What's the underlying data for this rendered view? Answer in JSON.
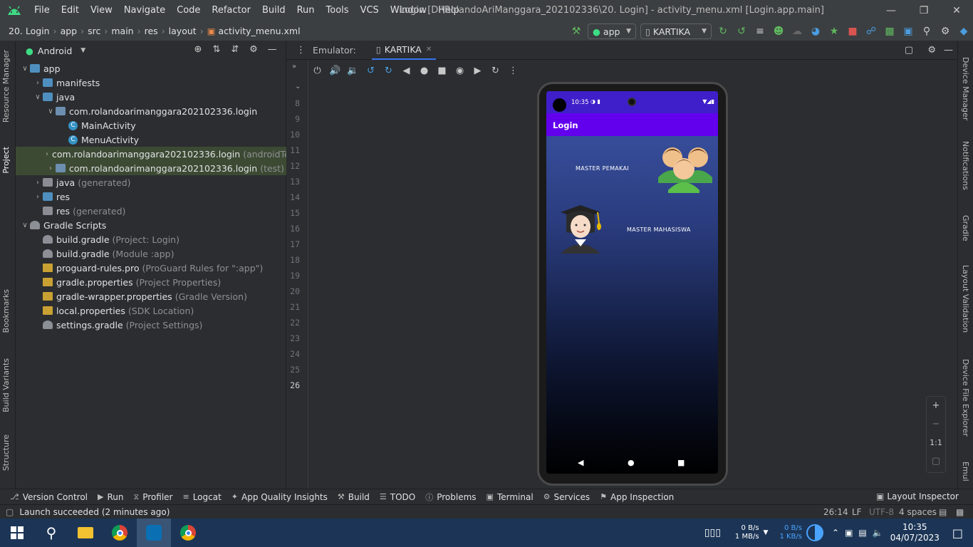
{
  "titlebar": {
    "menu": [
      "File",
      "Edit",
      "View",
      "Navigate",
      "Code",
      "Refactor",
      "Build",
      "Run",
      "Tools",
      "VCS",
      "Window",
      "Help"
    ],
    "title": "Login [D:\\RolandoAriManggara_202102336\\20. Login] - activity_menu.xml [Login.app.main]"
  },
  "navbar": {
    "crumbs": [
      "20. Login",
      "app",
      "src",
      "main",
      "res",
      "layout",
      "activity_menu.xml"
    ],
    "run_config": "app",
    "device": "KARTIKA"
  },
  "project": {
    "view": "Android",
    "tree": [
      {
        "label": "app",
        "hint": "",
        "icon": "folder",
        "indent": 0,
        "expanded": true
      },
      {
        "label": "manifests",
        "hint": "",
        "icon": "folder",
        "indent": 1,
        "expanded": false
      },
      {
        "label": "java",
        "hint": "",
        "icon": "folder",
        "indent": 1,
        "expanded": true
      },
      {
        "label": "com.rolandoarimanggara202102336.login",
        "hint": "",
        "icon": "pkg",
        "indent": 2,
        "expanded": true
      },
      {
        "label": "MainActivity",
        "hint": "",
        "icon": "class",
        "indent": 3
      },
      {
        "label": "MenuActivity",
        "hint": "",
        "icon": "class",
        "indent": 3
      },
      {
        "label": "com.rolandoarimanggara202102336.login",
        "hint": "(androidTest)",
        "icon": "pkg",
        "indent": 2,
        "expanded": false,
        "selected": true
      },
      {
        "label": "com.rolandoarimanggara202102336.login",
        "hint": "(test)",
        "icon": "pkg",
        "indent": 2,
        "expanded": false,
        "selected": true
      },
      {
        "label": "java",
        "hint": "(generated)",
        "icon": "folder-gray",
        "indent": 1,
        "expanded": false
      },
      {
        "label": "res",
        "hint": "",
        "icon": "folder",
        "indent": 1,
        "expanded": false
      },
      {
        "label": "res",
        "hint": "(generated)",
        "icon": "folder-gray",
        "indent": 1
      },
      {
        "label": "Gradle Scripts",
        "hint": "",
        "icon": "gradle",
        "indent": 0,
        "expanded": true
      },
      {
        "label": "build.gradle",
        "hint": "(Project: Login)",
        "icon": "gradle",
        "indent": 1
      },
      {
        "label": "build.gradle",
        "hint": "(Module :app)",
        "icon": "gradle",
        "indent": 1
      },
      {
        "label": "proguard-rules.pro",
        "hint": "(ProGuard Rules for \":app\")",
        "icon": "prop",
        "indent": 1
      },
      {
        "label": "gradle.properties",
        "hint": "(Project Properties)",
        "icon": "prop",
        "indent": 1
      },
      {
        "label": "gradle-wrapper.properties",
        "hint": "(Gradle Version)",
        "icon": "prop",
        "indent": 1
      },
      {
        "label": "local.properties",
        "hint": "(SDK Location)",
        "icon": "prop",
        "indent": 1
      },
      {
        "label": "settings.gradle",
        "hint": "(Project Settings)",
        "icon": "gradle",
        "indent": 1
      }
    ]
  },
  "left_strip": [
    "Resource Manager",
    "Project",
    "Bookmarks",
    "Build Variants",
    "Structure"
  ],
  "right_strip": [
    "Device Manager",
    "Notifications",
    "Gradle",
    "Layout Validation",
    "Device File Explorer",
    "Emul"
  ],
  "gutter": {
    "lines": [
      "8",
      "9",
      "10",
      "11",
      "12",
      "13",
      "14",
      "15",
      "16",
      "17",
      "18",
      "19",
      "20",
      "21",
      "22",
      "23",
      "24",
      "25",
      "26"
    ],
    "current": "26"
  },
  "emulator": {
    "label": "Emulator:",
    "tab": "KARTIKA",
    "phone": {
      "time": "10:35",
      "app_title": "Login",
      "btn1": "MASTER PEMAKAI",
      "btn2": "MASTER MAHASISWA"
    },
    "zoom": [
      "+",
      "−",
      "1:1"
    ]
  },
  "bottom_tabs": [
    "Version Control",
    "Run",
    "Profiler",
    "Logcat",
    "App Quality Insights",
    "Build",
    "TODO",
    "Problems",
    "Terminal",
    "Services",
    "App Inspection"
  ],
  "layout_inspector": "Layout Inspector",
  "status": {
    "message": "Launch succeeded (2 minutes ago)",
    "position": "26:14",
    "line_sep": "LF",
    "encoding": "UTF-8",
    "indent": "4 spaces"
  },
  "taskbar": {
    "net_up": "0 B/s",
    "net_down": "1 MB/s",
    "net_up2": "0 B/s",
    "net_down2": "1 KB/s",
    "time": "10:35",
    "date": "04/07/2023"
  },
  "colors": {
    "accent": "#3574f0",
    "appbar": "#6200ee",
    "statusbar": "#3f1fc9"
  }
}
